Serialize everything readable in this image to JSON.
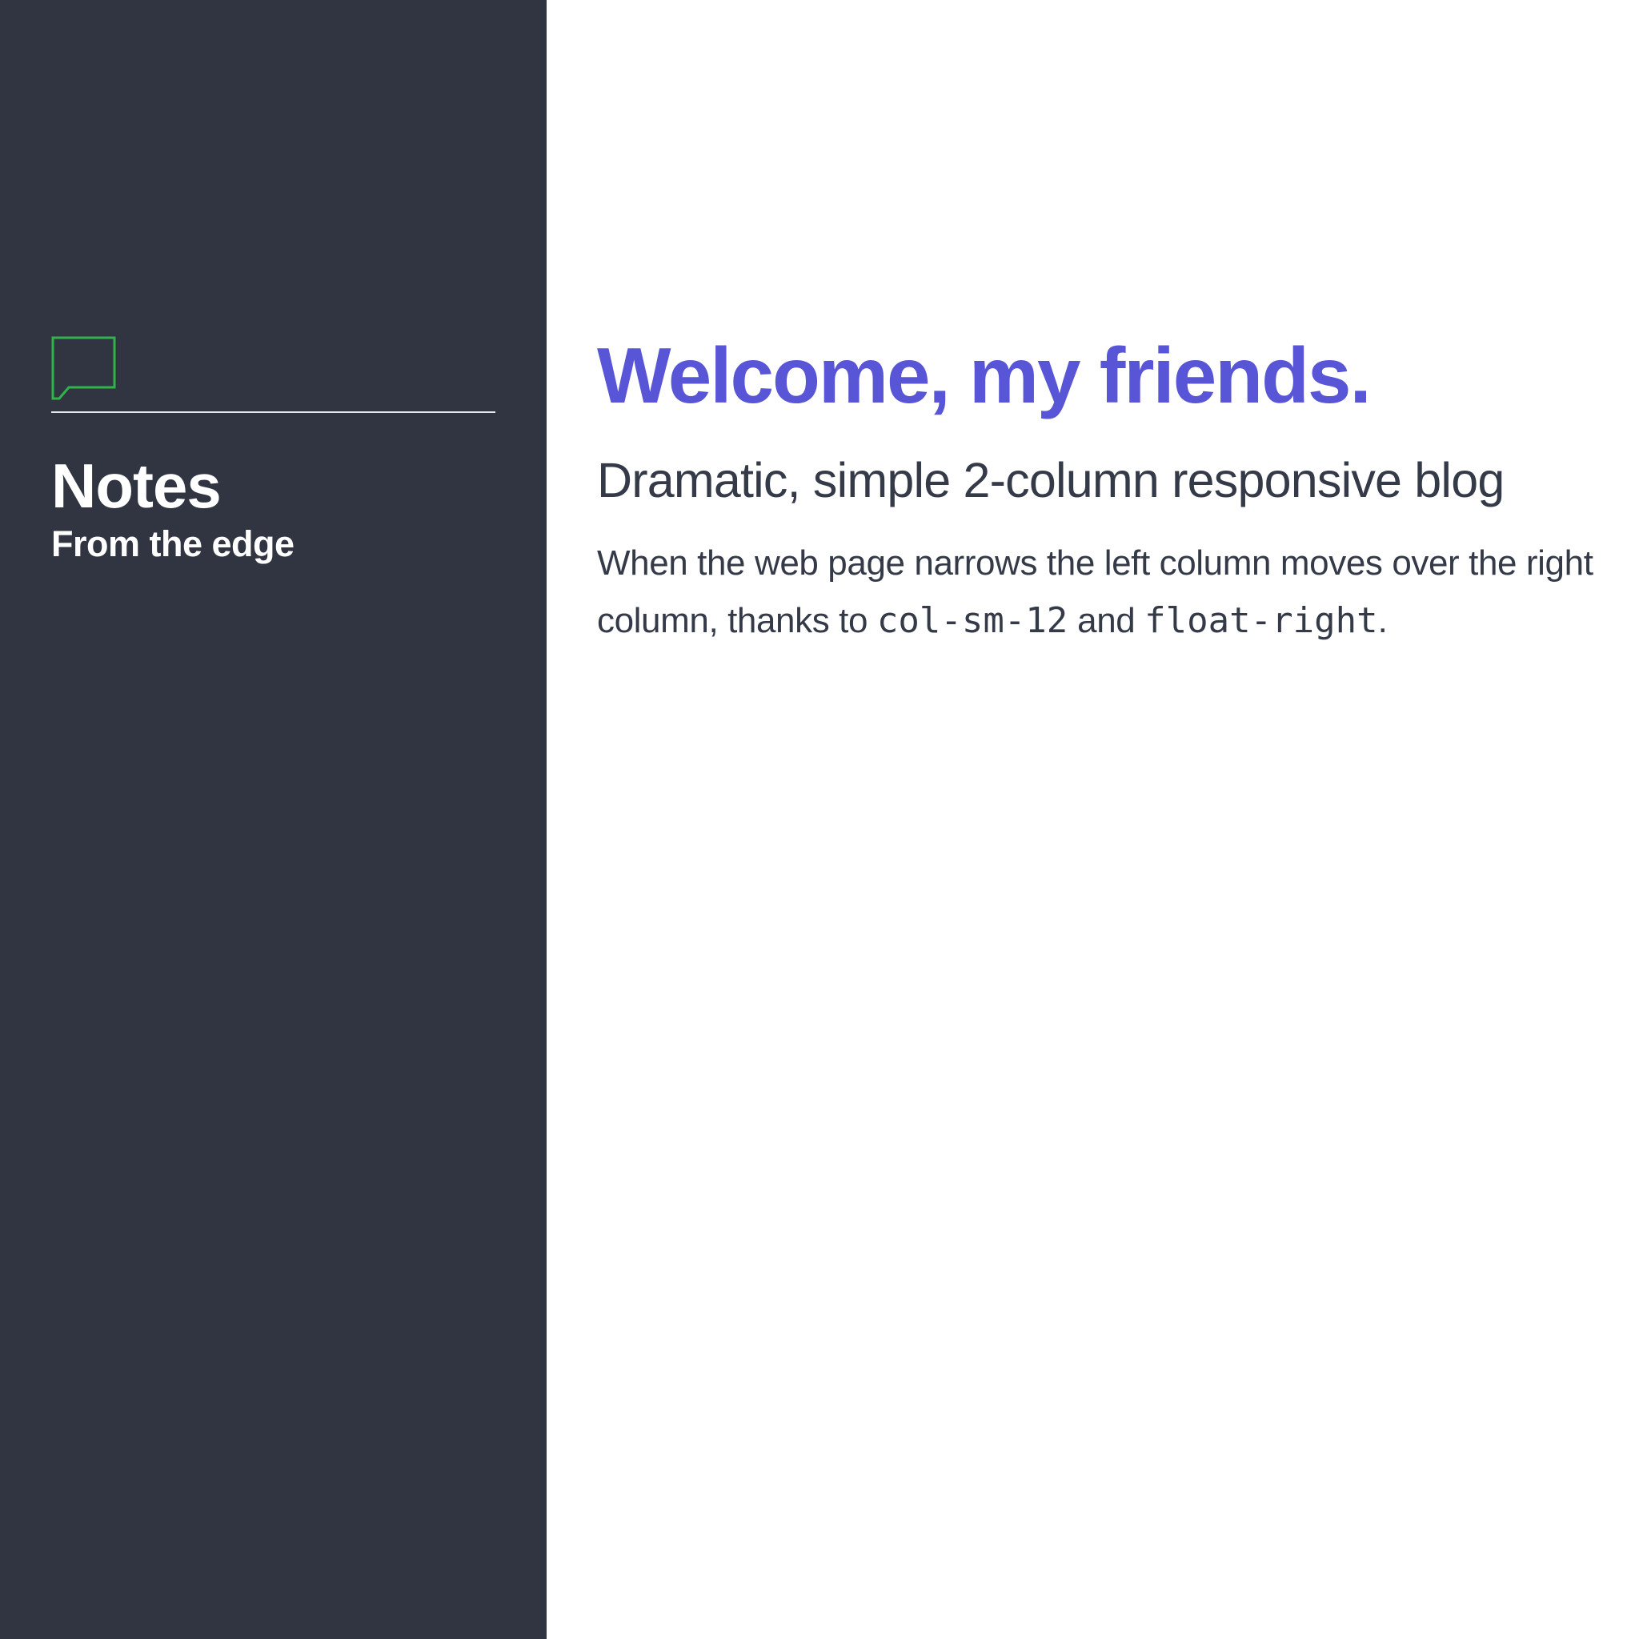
{
  "sidebar": {
    "icon": "chat-bubble-icon",
    "icon_color": "#2fb34a",
    "background": "#303541",
    "title": "Notes",
    "subtitle": "From the edge"
  },
  "main": {
    "heading": "Welcome, my friends.",
    "heading_color": "#5856d6",
    "subheading": "Dramatic, simple 2-column responsive blog",
    "paragraph": {
      "text_before": "When the web page narrows the left column moves over the right column, thanks to ",
      "code_1": "col-sm-12",
      "text_middle": " and ",
      "code_2": "float-right",
      "text_after": "."
    }
  }
}
